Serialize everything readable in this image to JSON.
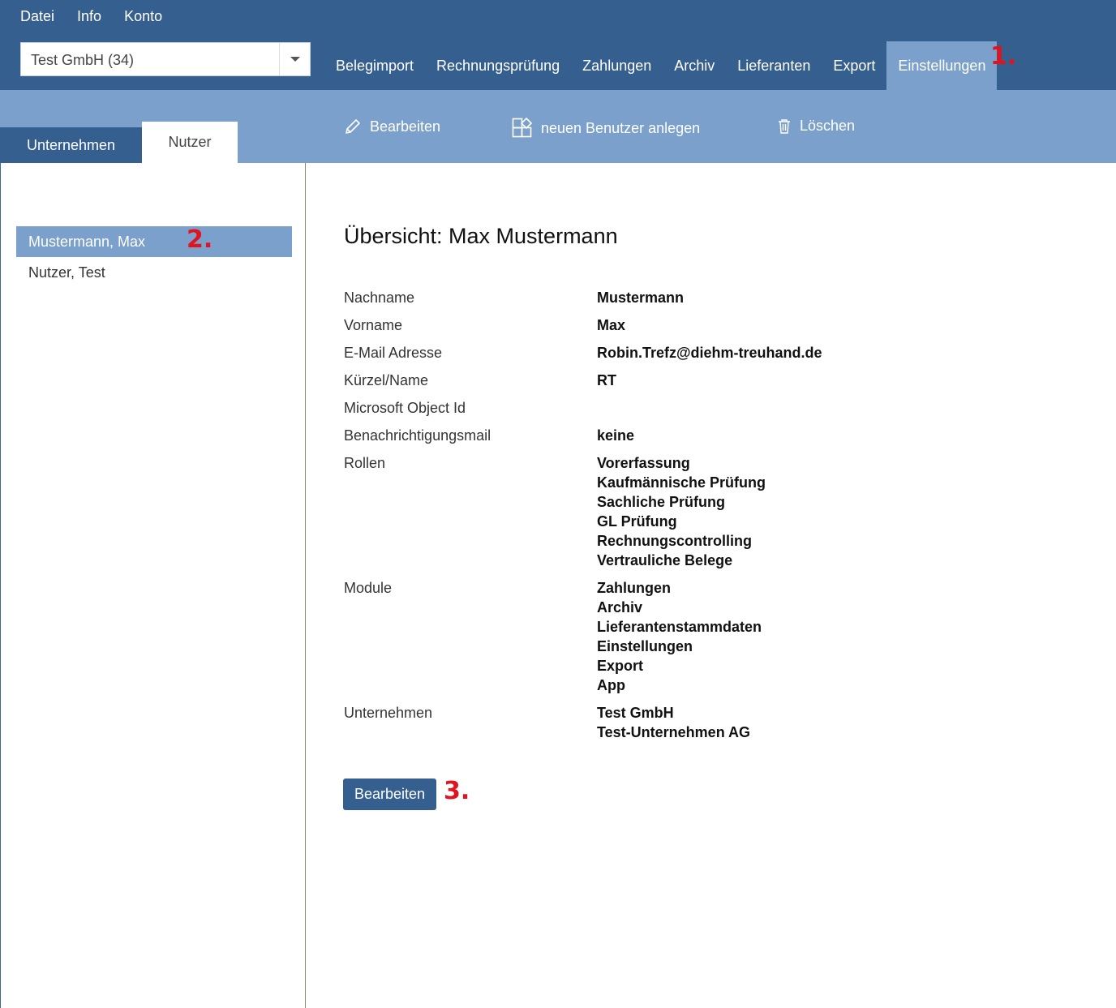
{
  "menubar": {
    "items": [
      "Datei",
      "Info",
      "Konto"
    ]
  },
  "company_select": {
    "value": "Test GmbH (34)"
  },
  "nav": {
    "tabs": [
      "Belegimport",
      "Rechnungsprüfung",
      "Zahlungen",
      "Archiv",
      "Lieferanten",
      "Export",
      "Einstellungen"
    ],
    "active": "Einstellungen"
  },
  "markers": {
    "m1": "1.",
    "m2": "2.",
    "m3": "3."
  },
  "subtabs": {
    "firm": "Unternehmen",
    "user": "Nutzer"
  },
  "toolbar": {
    "edit": "Bearbeiten",
    "new_user": "neuen Benutzer anlegen",
    "delete": "Löschen"
  },
  "users": [
    "Mustermann, Max",
    "Nutzer, Test"
  ],
  "detail": {
    "title": "Übersicht: Max  Mustermann",
    "fields": [
      {
        "label": "Nachname",
        "values": [
          "Mustermann"
        ]
      },
      {
        "label": "Vorname",
        "values": [
          "Max"
        ]
      },
      {
        "label": "E-Mail Adresse",
        "values": [
          "Robin.Trefz@diehm-treuhand.de"
        ]
      },
      {
        "label": "Kürzel/Name",
        "values": [
          "RT"
        ]
      },
      {
        "label": "Microsoft Object Id",
        "values": [
          ""
        ]
      },
      {
        "label": "Benachrichtigungsmail",
        "values": [
          "keine"
        ]
      },
      {
        "label": "Rollen",
        "values": [
          "Vorerfassung",
          "Kaufmännische Prüfung",
          "Sachliche Prüfung",
          "GL Prüfung",
          "Rechnungscontrolling",
          "Vertrauliche Belege"
        ]
      },
      {
        "label": "Module",
        "values": [
          "Zahlungen",
          "Archiv",
          "Lieferantenstammdaten",
          "Einstellungen",
          "Export",
          "App"
        ]
      },
      {
        "label": "Unternehmen",
        "values": [
          "Test GmbH",
          "Test-Unternehmen AG"
        ]
      }
    ],
    "edit_button": "Bearbeiten"
  },
  "colors": {
    "header": "#355f8f",
    "accent": "#7aa0cb",
    "marker": "#e0141e"
  }
}
